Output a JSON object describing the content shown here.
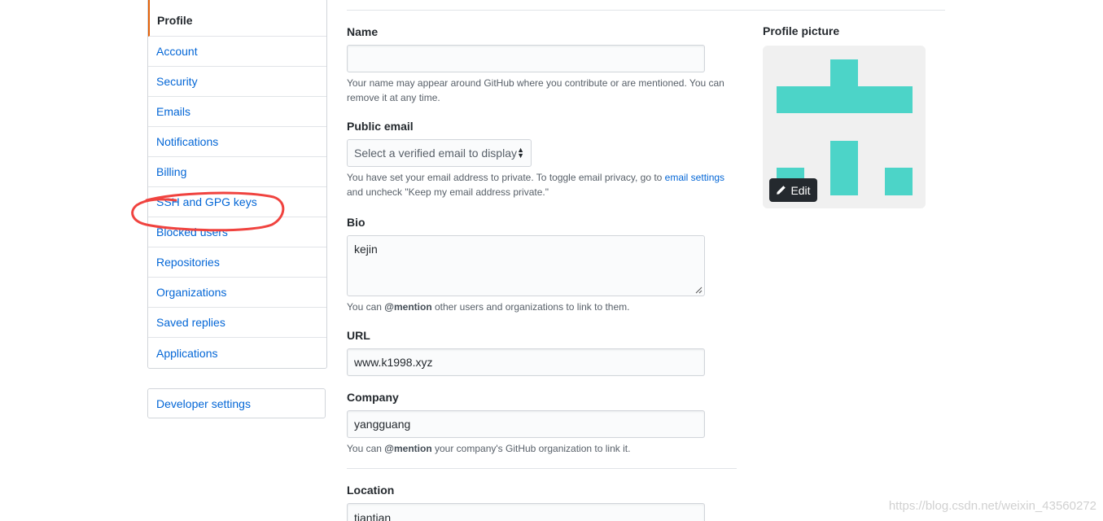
{
  "sidebar": {
    "items": [
      {
        "label": "Profile",
        "active": true
      },
      {
        "label": "Account"
      },
      {
        "label": "Security"
      },
      {
        "label": "Emails"
      },
      {
        "label": "Notifications"
      },
      {
        "label": "Billing"
      },
      {
        "label": "SSH and GPG keys",
        "highlighted": true
      },
      {
        "label": "Blocked users"
      },
      {
        "label": "Repositories"
      },
      {
        "label": "Organizations"
      },
      {
        "label": "Saved replies"
      },
      {
        "label": "Applications"
      }
    ],
    "developer_settings": "Developer settings"
  },
  "form": {
    "name": {
      "label": "Name",
      "value": "",
      "note": "Your name may appear around GitHub where you contribute or are mentioned. You can remove it at any time."
    },
    "public_email": {
      "label": "Public email",
      "placeholder": "Select a verified email to display",
      "note_pre": "You have set your email address to private. To toggle email privacy, go to",
      "note_link": "email settings",
      "note_post": "and uncheck \"Keep my email address private.\""
    },
    "bio": {
      "label": "Bio",
      "value": "kejin",
      "note_pre": "You can",
      "note_mention": "@mention",
      "note_post": "other users and organizations to link to them."
    },
    "url": {
      "label": "URL",
      "value": "www.k1998.xyz"
    },
    "company": {
      "label": "Company",
      "value": "yangguang",
      "note_pre": "You can",
      "note_mention": "@mention",
      "note_post": "your company's GitHub organization to link it."
    },
    "location": {
      "label": "Location",
      "value": "tiantian"
    }
  },
  "profile_picture": {
    "label": "Profile picture",
    "edit_label": "Edit",
    "avatar_color": "#4cd4c8"
  },
  "annotation": {
    "color": "#f0433f",
    "target": "SSH and GPG keys"
  },
  "watermark": "https://blog.csdn.net/weixin_43560272",
  "colors": {
    "link": "#0366d6",
    "active_marker": "#e36209"
  }
}
